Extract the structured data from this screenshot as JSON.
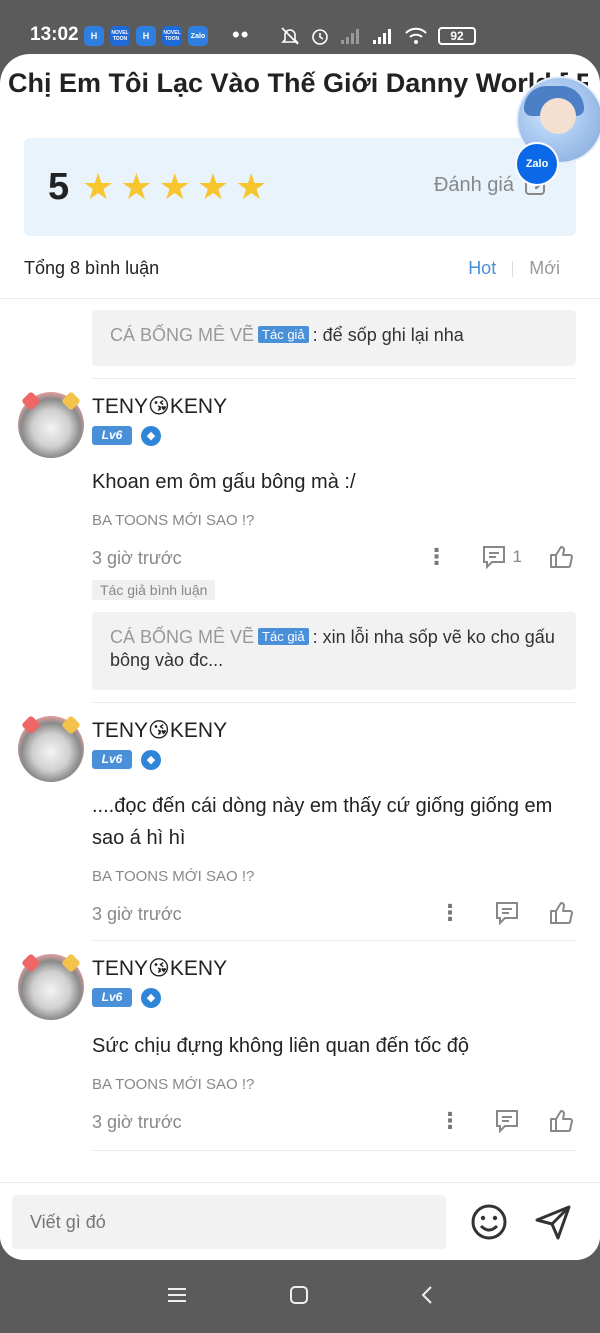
{
  "status": {
    "time": "13:02",
    "app_icons": [
      "H",
      "NOVEL TOON",
      "H",
      "NOVEL TOON",
      "Zalo"
    ],
    "battery": "92"
  },
  "header": {
    "title": "Chị Em Tôi Lạc Vào Thế Giới Danny World [ R..."
  },
  "zalo": {
    "label": "Zalo"
  },
  "rating": {
    "score": "5",
    "stars": 5,
    "action_label": "Đánh giá"
  },
  "comments_bar": {
    "total": "Tổng 8 bình luận",
    "sort_hot": "Hot",
    "sort_new": "Mới"
  },
  "top_reply": {
    "name": "CÁ BỐNG MÊ VẼ",
    "tag": "Tác giả",
    "text": ": để sốp ghi lại nha"
  },
  "comments": [
    {
      "user": "TENY😘KENY",
      "level": "Lv6",
      "text": "Khoan em ôm gấu bông mà :/",
      "chapter": "BA TOONS MỚI SAO !?",
      "time": "3 giờ trước",
      "reply_count": "1",
      "author_commented": "Tác giả bình luận",
      "reply": {
        "name": "CÁ BỐNG MÊ VẼ",
        "tag": "Tác giả",
        "text": ": xin lỗi nha sốp vẽ ko cho gấu bông vào đc..."
      }
    },
    {
      "user": "TENY😘KENY",
      "level": "Lv6",
      "text": "....đọc đến cái dòng này em thấy cứ giống  giống em sao á hì hì",
      "chapter": "BA TOONS MỚI SAO !?",
      "time": "3 giờ trước"
    },
    {
      "user": "TENY😘KENY",
      "level": "Lv6",
      "text": "Sức chịu đựng không liên quan đến tốc độ",
      "chapter": "BA TOONS MỚI SAO !?",
      "time": "3 giờ trước"
    }
  ],
  "composer": {
    "placeholder": "Viết gì đó"
  },
  "icons": {
    "status": [
      "muted-bell-icon",
      "alarm-icon",
      "signal-icon",
      "wifi-icon",
      "battery-icon"
    ],
    "rating": [
      "star-icon",
      "edit-icon"
    ],
    "comment": [
      "more-icon",
      "reply-icon",
      "like-icon"
    ],
    "composer": [
      "emoji-icon",
      "send-icon"
    ],
    "nav": [
      "menu-icon",
      "home-icon",
      "back-icon"
    ]
  },
  "colors": {
    "accent": "#4a90d9",
    "star": "#f7c62f",
    "card_bg": "#e9f3fc",
    "zalo": "#0b68e6"
  }
}
